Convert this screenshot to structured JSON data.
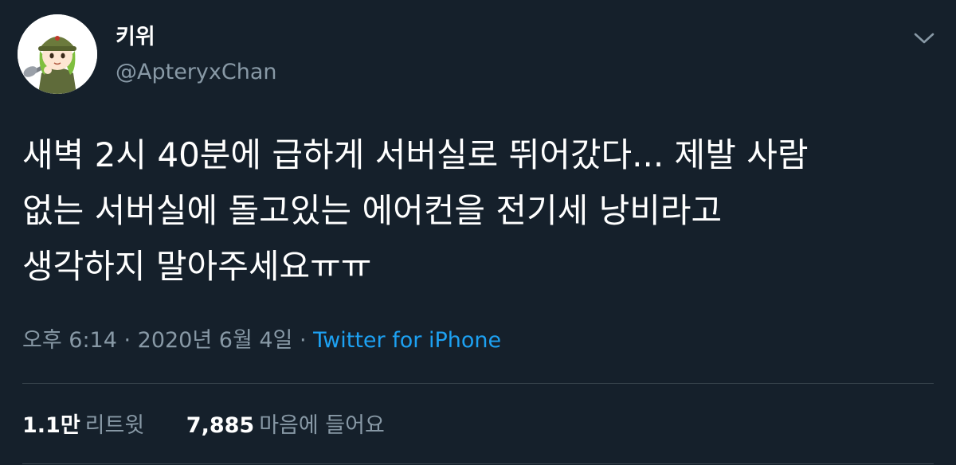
{
  "user": {
    "display_name": "키위",
    "handle": "@ApteryxChan"
  },
  "tweet": {
    "lines": [
      "새벽 2시 40분에 급하게 서버실로 뛰어갔다... 제발 사람",
      "없는 서버실에 돌고있는 에어컨을 전기세 낭비라고",
      "생각하지 말아주세요ㅠㅠ"
    ]
  },
  "meta": {
    "timestamp": "오후 6:14 · 2020년 6월 4일",
    "separator": " · ",
    "source": "Twitter for iPhone"
  },
  "stats": {
    "retweets_count": "1.1만",
    "retweets_label": "리트윗",
    "likes_count": "7,885",
    "likes_label": "마음에 들어요"
  },
  "colors": {
    "background": "#15202b",
    "secondary_text": "#8899a6",
    "link": "#1da1f2",
    "divider": "#38444d"
  },
  "icons": {
    "caret": "chevron-down-icon",
    "avatar": "avatar-cartoon-soldier"
  }
}
